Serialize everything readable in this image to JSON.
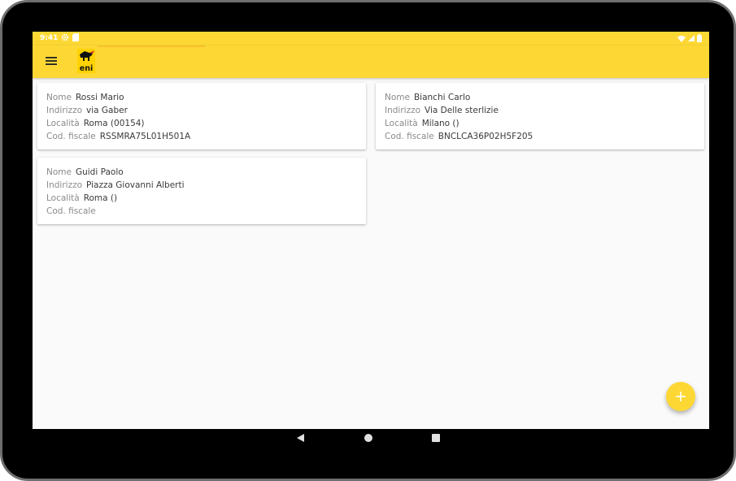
{
  "status_bar": {
    "time": "9:41"
  },
  "colors": {
    "accent": "#fdd835",
    "accent_dark": "#fbc02d",
    "bezel": "#000000",
    "background": "#fafafa"
  },
  "icons": {
    "menu": "menu-icon",
    "logo": "eni-logo",
    "settings": "gear-icon",
    "sd": "sd-card-icon",
    "wifi": "wifi-icon",
    "signal": "signal-icon",
    "battery": "battery-icon",
    "fab": "plus-icon",
    "back": "back-icon",
    "home": "home-icon",
    "recents": "recents-icon"
  },
  "field_labels": {
    "nome": "Nome",
    "indirizzo": "Indirizzo",
    "localita": "Località",
    "cod_fiscale": "Cod. fiscale"
  },
  "customers": [
    {
      "nome": "Rossi Mario",
      "indirizzo": "via Gaber",
      "localita": "Roma (00154)",
      "cod_fiscale": "RSSMRA75L01H501A"
    },
    {
      "nome": "Bianchi Carlo",
      "indirizzo": "Via Delle sterlizie",
      "localita": "Milano ()",
      "cod_fiscale": "BNCLCA36P02H5F205"
    },
    {
      "nome": "Guidi Paolo",
      "indirizzo": "Piazza Giovanni Alberti",
      "localita": "Roma ()",
      "cod_fiscale": ""
    }
  ]
}
